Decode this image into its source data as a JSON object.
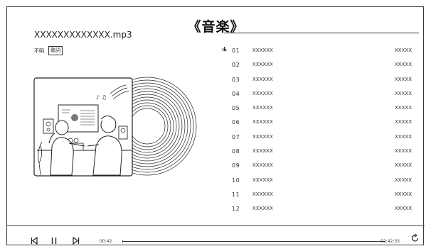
{
  "header": {
    "title": "《音楽》"
  },
  "now_playing": {
    "title": "XXXXXXXXXXXXX.mp3",
    "artist": "不明",
    "lyrics_button": "歌詞"
  },
  "tracks": [
    {
      "num": "01",
      "name": "XXXXXX",
      "extra": "XXXXX",
      "playing": true
    },
    {
      "num": "02",
      "name": "XXXXXX",
      "extra": "XXXXX",
      "playing": false
    },
    {
      "num": "03",
      "name": "XXXXXX",
      "extra": "XXXXX",
      "playing": false
    },
    {
      "num": "04",
      "name": "XXXXXX",
      "extra": "XXXXX",
      "playing": false
    },
    {
      "num": "05",
      "name": "XXXXXX",
      "extra": "XXXXX",
      "playing": false
    },
    {
      "num": "06",
      "name": "XXXXXX",
      "extra": "XXXXX",
      "playing": false
    },
    {
      "num": "07",
      "name": "XXXXXX",
      "extra": "XXXXX",
      "playing": false
    },
    {
      "num": "08",
      "name": "XXXXXX",
      "extra": "XXXXX",
      "playing": false
    },
    {
      "num": "09",
      "name": "XXXXXX",
      "extra": "XXXXX",
      "playing": false
    },
    {
      "num": "10",
      "name": "XXXXXX",
      "extra": "XXXXX",
      "playing": false
    },
    {
      "num": "11",
      "name": "XXXXXX",
      "extra": "XXXXX",
      "playing": false
    },
    {
      "num": "12",
      "name": "XXXXXX",
      "extra": "XXXXX",
      "playing": false
    }
  ],
  "player": {
    "elapsed": "00:42",
    "total": "02:42:33",
    "progress_fraction": 0.004,
    "icons": {
      "prev": "skip-previous-icon",
      "pause": "pause-icon",
      "next": "skip-next-icon",
      "repeat": "repeat-icon",
      "playing": "now-playing-icon"
    }
  },
  "colors": {
    "line": "#333333",
    "background": "#ffffff"
  }
}
